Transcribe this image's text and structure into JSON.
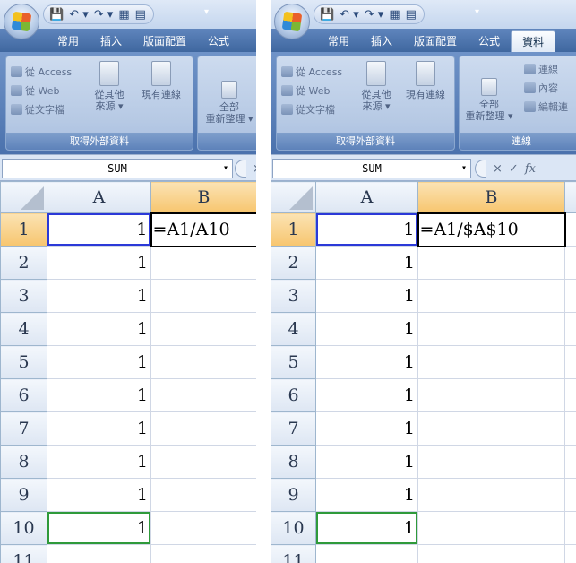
{
  "panels": [
    {
      "qat": [
        "💾",
        "↶ ▾",
        "↷ ▾",
        "▦",
        "▤"
      ],
      "qat_dropdown": "▾",
      "tabs": [
        "常用",
        "插入",
        "版面配置",
        "公式"
      ],
      "active_tab": -1,
      "groups": [
        {
          "label": "取得外部資料",
          "small_buttons": [
            "從 Access",
            "從 Web",
            "從文字檔"
          ],
          "large_buttons": [
            {
              "label": "從其他\n來源 ▾"
            },
            {
              "label": "現有連線"
            }
          ]
        },
        {
          "label": "",
          "large_buttons": [
            {
              "label": "全部\n重新整理 ▾"
            }
          ],
          "small_buttons": []
        }
      ],
      "name_box": "SUM",
      "name_box_dropdown": "▾",
      "formula_buttons": [
        "×"
      ],
      "columns": [
        "A",
        "B"
      ],
      "rows": [
        "1",
        "2",
        "3",
        "4",
        "5",
        "6",
        "7",
        "8",
        "9",
        "10",
        "11"
      ],
      "col_a_values": [
        "1",
        "1",
        "1",
        "1",
        "1",
        "1",
        "1",
        "1",
        "1",
        "1",
        ""
      ],
      "b1_formula": "=A1/A10"
    },
    {
      "qat": [
        "💾",
        "↶ ▾",
        "↷ ▾",
        "▦",
        "▤"
      ],
      "qat_dropdown": "▾",
      "tabs": [
        "常用",
        "插入",
        "版面配置",
        "公式",
        "資料"
      ],
      "active_tab": 4,
      "groups": [
        {
          "label": "取得外部資料",
          "small_buttons": [
            "從 Access",
            "從 Web",
            "從文字檔"
          ],
          "large_buttons": [
            {
              "label": "從其他\n來源 ▾"
            },
            {
              "label": "現有連線"
            }
          ]
        },
        {
          "label": "連線",
          "large_buttons": [
            {
              "label": "全部\n重新整理 ▾"
            }
          ],
          "small_buttons": [
            "連線",
            "內容",
            "編輯連"
          ]
        }
      ],
      "name_box": "SUM",
      "name_box_dropdown": "▾",
      "formula_buttons": [
        "×",
        "✓",
        "fx"
      ],
      "columns": [
        "A",
        "B"
      ],
      "rows": [
        "1",
        "2",
        "3",
        "4",
        "5",
        "6",
        "7",
        "8",
        "9",
        "10",
        "11"
      ],
      "col_a_values": [
        "1",
        "1",
        "1",
        "1",
        "1",
        "1",
        "1",
        "1",
        "1",
        "1",
        ""
      ],
      "b1_formula": "=A1/$A$10"
    }
  ]
}
